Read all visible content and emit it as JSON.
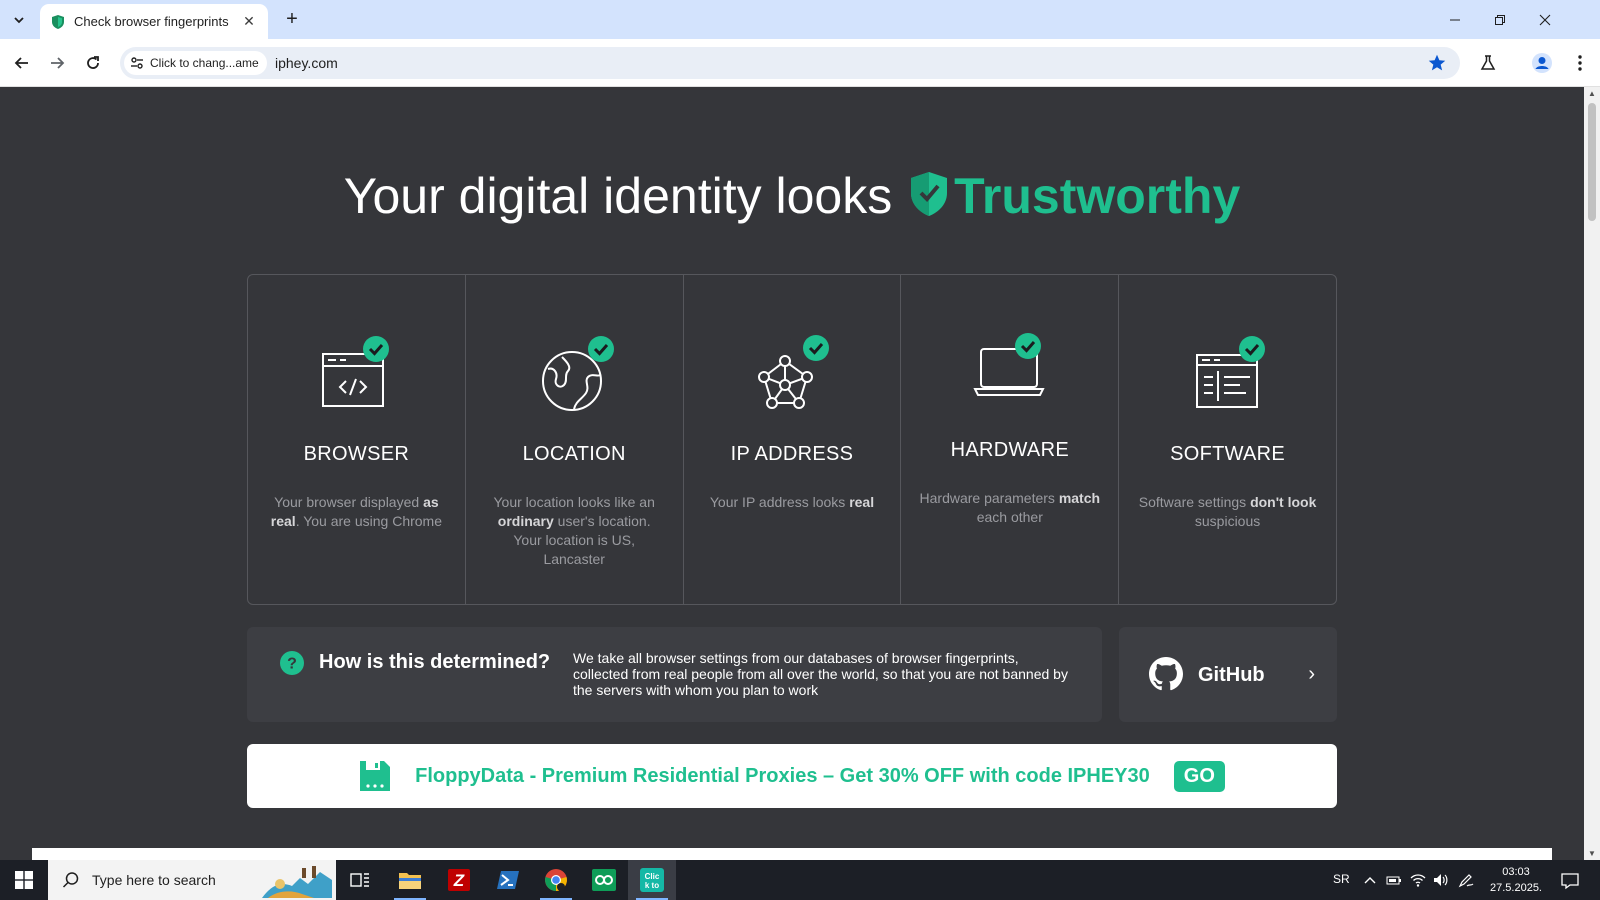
{
  "browser": {
    "tab_title": "Check browser fingerprints",
    "site_chip": "Click to chang...ame",
    "url": "iphey.com"
  },
  "page": {
    "headline_prefix": "Your digital identity looks",
    "headline_status": "Trustworthy",
    "cards": [
      {
        "title": "BROWSER",
        "desc_html": "Your browser displayed <b>as real</b>. You are using Chrome",
        "icon": "browser-code-icon"
      },
      {
        "title": "LOCATION",
        "desc_html": "Your location looks like an <b>ordinary</b> user's location. Your location is US, Lancaster",
        "icon": "globe-icon"
      },
      {
        "title": "IP ADDRESS",
        "desc_html": "Your IP address looks <b>real</b>",
        "icon": "network-icon"
      },
      {
        "title": "HARDWARE",
        "desc_html": "Hardware parameters <b>match</b> each other",
        "icon": "laptop-icon"
      },
      {
        "title": "SOFTWARE",
        "desc_html": "Software settings <b>don't look</b> suspicious",
        "icon": "software-window-icon"
      }
    ],
    "info": {
      "title": "How is this determined?",
      "text": "We take all browser settings from our databases of browser fingerprints, collected from real people from all over the world, so that you are not banned by the servers with whom you plan to work"
    },
    "github": {
      "label": "GitHub",
      "arrow": "›"
    },
    "promo": {
      "text": "FloppyData - Premium Residential Proxies – Get 30% OFF with code IPHEY30",
      "button": "GO"
    }
  },
  "taskbar": {
    "search_placeholder": "Type here to search",
    "lang": "SR",
    "time": "03:03",
    "date": "27.5.2025."
  },
  "colors": {
    "accent": "#1fbf8f",
    "page_bg": "#35363a",
    "tab_strip": "#d3e3fd"
  }
}
